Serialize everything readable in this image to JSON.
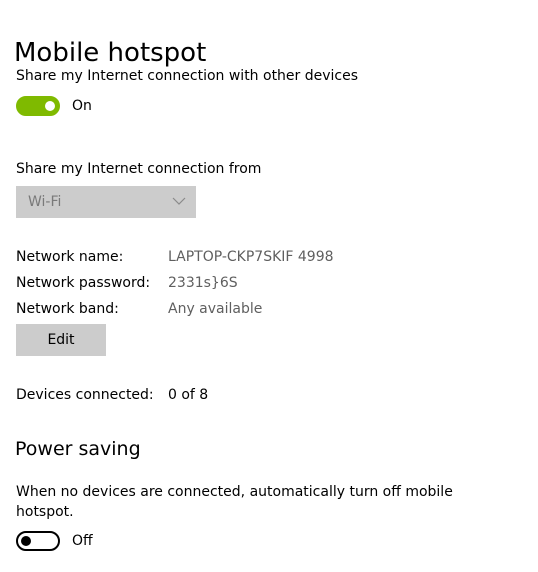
{
  "page": {
    "title": "Mobile hotspot"
  },
  "sharing": {
    "label": "Share my Internet connection with other devices",
    "toggle_state": "On",
    "toggle_on": true,
    "accent_color": "#7fba00"
  },
  "share_from": {
    "label": "Share my Internet connection from",
    "selected": "Wi-Fi",
    "chevron_icon": "chevron-down-icon",
    "disabled": true
  },
  "network": {
    "name_label": "Network name:",
    "name_value": "LAPTOP-CKP7SKIF 4998",
    "password_label": "Network password:",
    "password_value": "2331s}6S",
    "band_label": "Network band:",
    "band_value": "Any available",
    "edit_label": "Edit"
  },
  "devices": {
    "label": "Devices connected:",
    "value": "0 of 8"
  },
  "power_saving": {
    "title": "Power saving",
    "description": "When no devices are connected, automatically turn off mobile hotspot.",
    "toggle_state": "Off",
    "toggle_on": false
  }
}
